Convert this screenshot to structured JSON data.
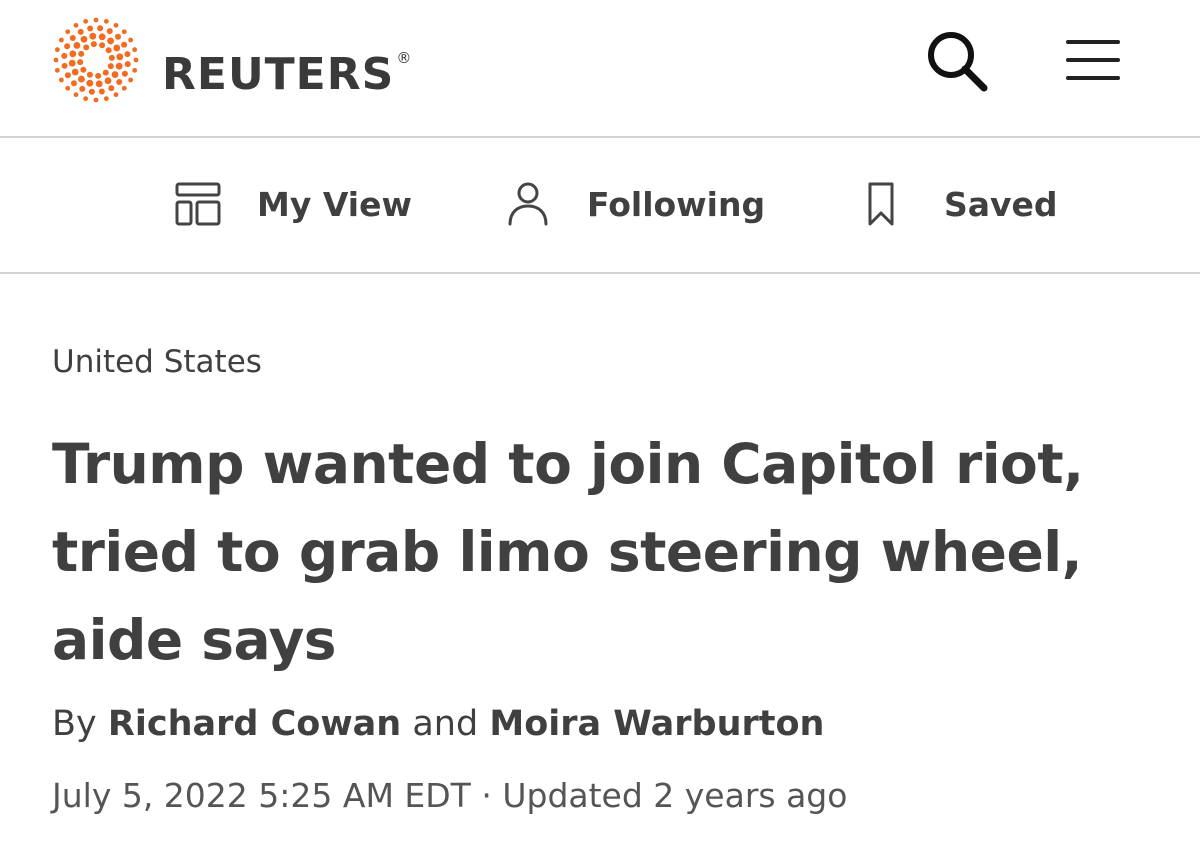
{
  "header": {
    "brand": "REUTERS",
    "brand_mark": "®",
    "logo_icon": "reuters-dot-logo",
    "search_icon": "search-icon",
    "menu_icon": "hamburger-menu-icon",
    "colors": {
      "brand_orange": "#f26b21",
      "text": "#404040",
      "divider": "#d4d4d4"
    }
  },
  "subnav": {
    "items": [
      {
        "label": "My View",
        "icon": "layout-grid-icon"
      },
      {
        "label": "Following",
        "icon": "person-icon"
      },
      {
        "label": "Saved",
        "icon": "bookmark-icon"
      }
    ]
  },
  "article": {
    "section": "United States",
    "headline": "Trump wanted to join Capitol riot, tried to grab limo steering wheel, aide says",
    "byline": {
      "prefix": "By",
      "author1": "Richard Cowan",
      "conjunction": "and",
      "author2": "Moira Warburton"
    },
    "published": "July 5, 2022 5:25 AM EDT",
    "separator": "·",
    "updated": "Updated 2 years ago"
  }
}
